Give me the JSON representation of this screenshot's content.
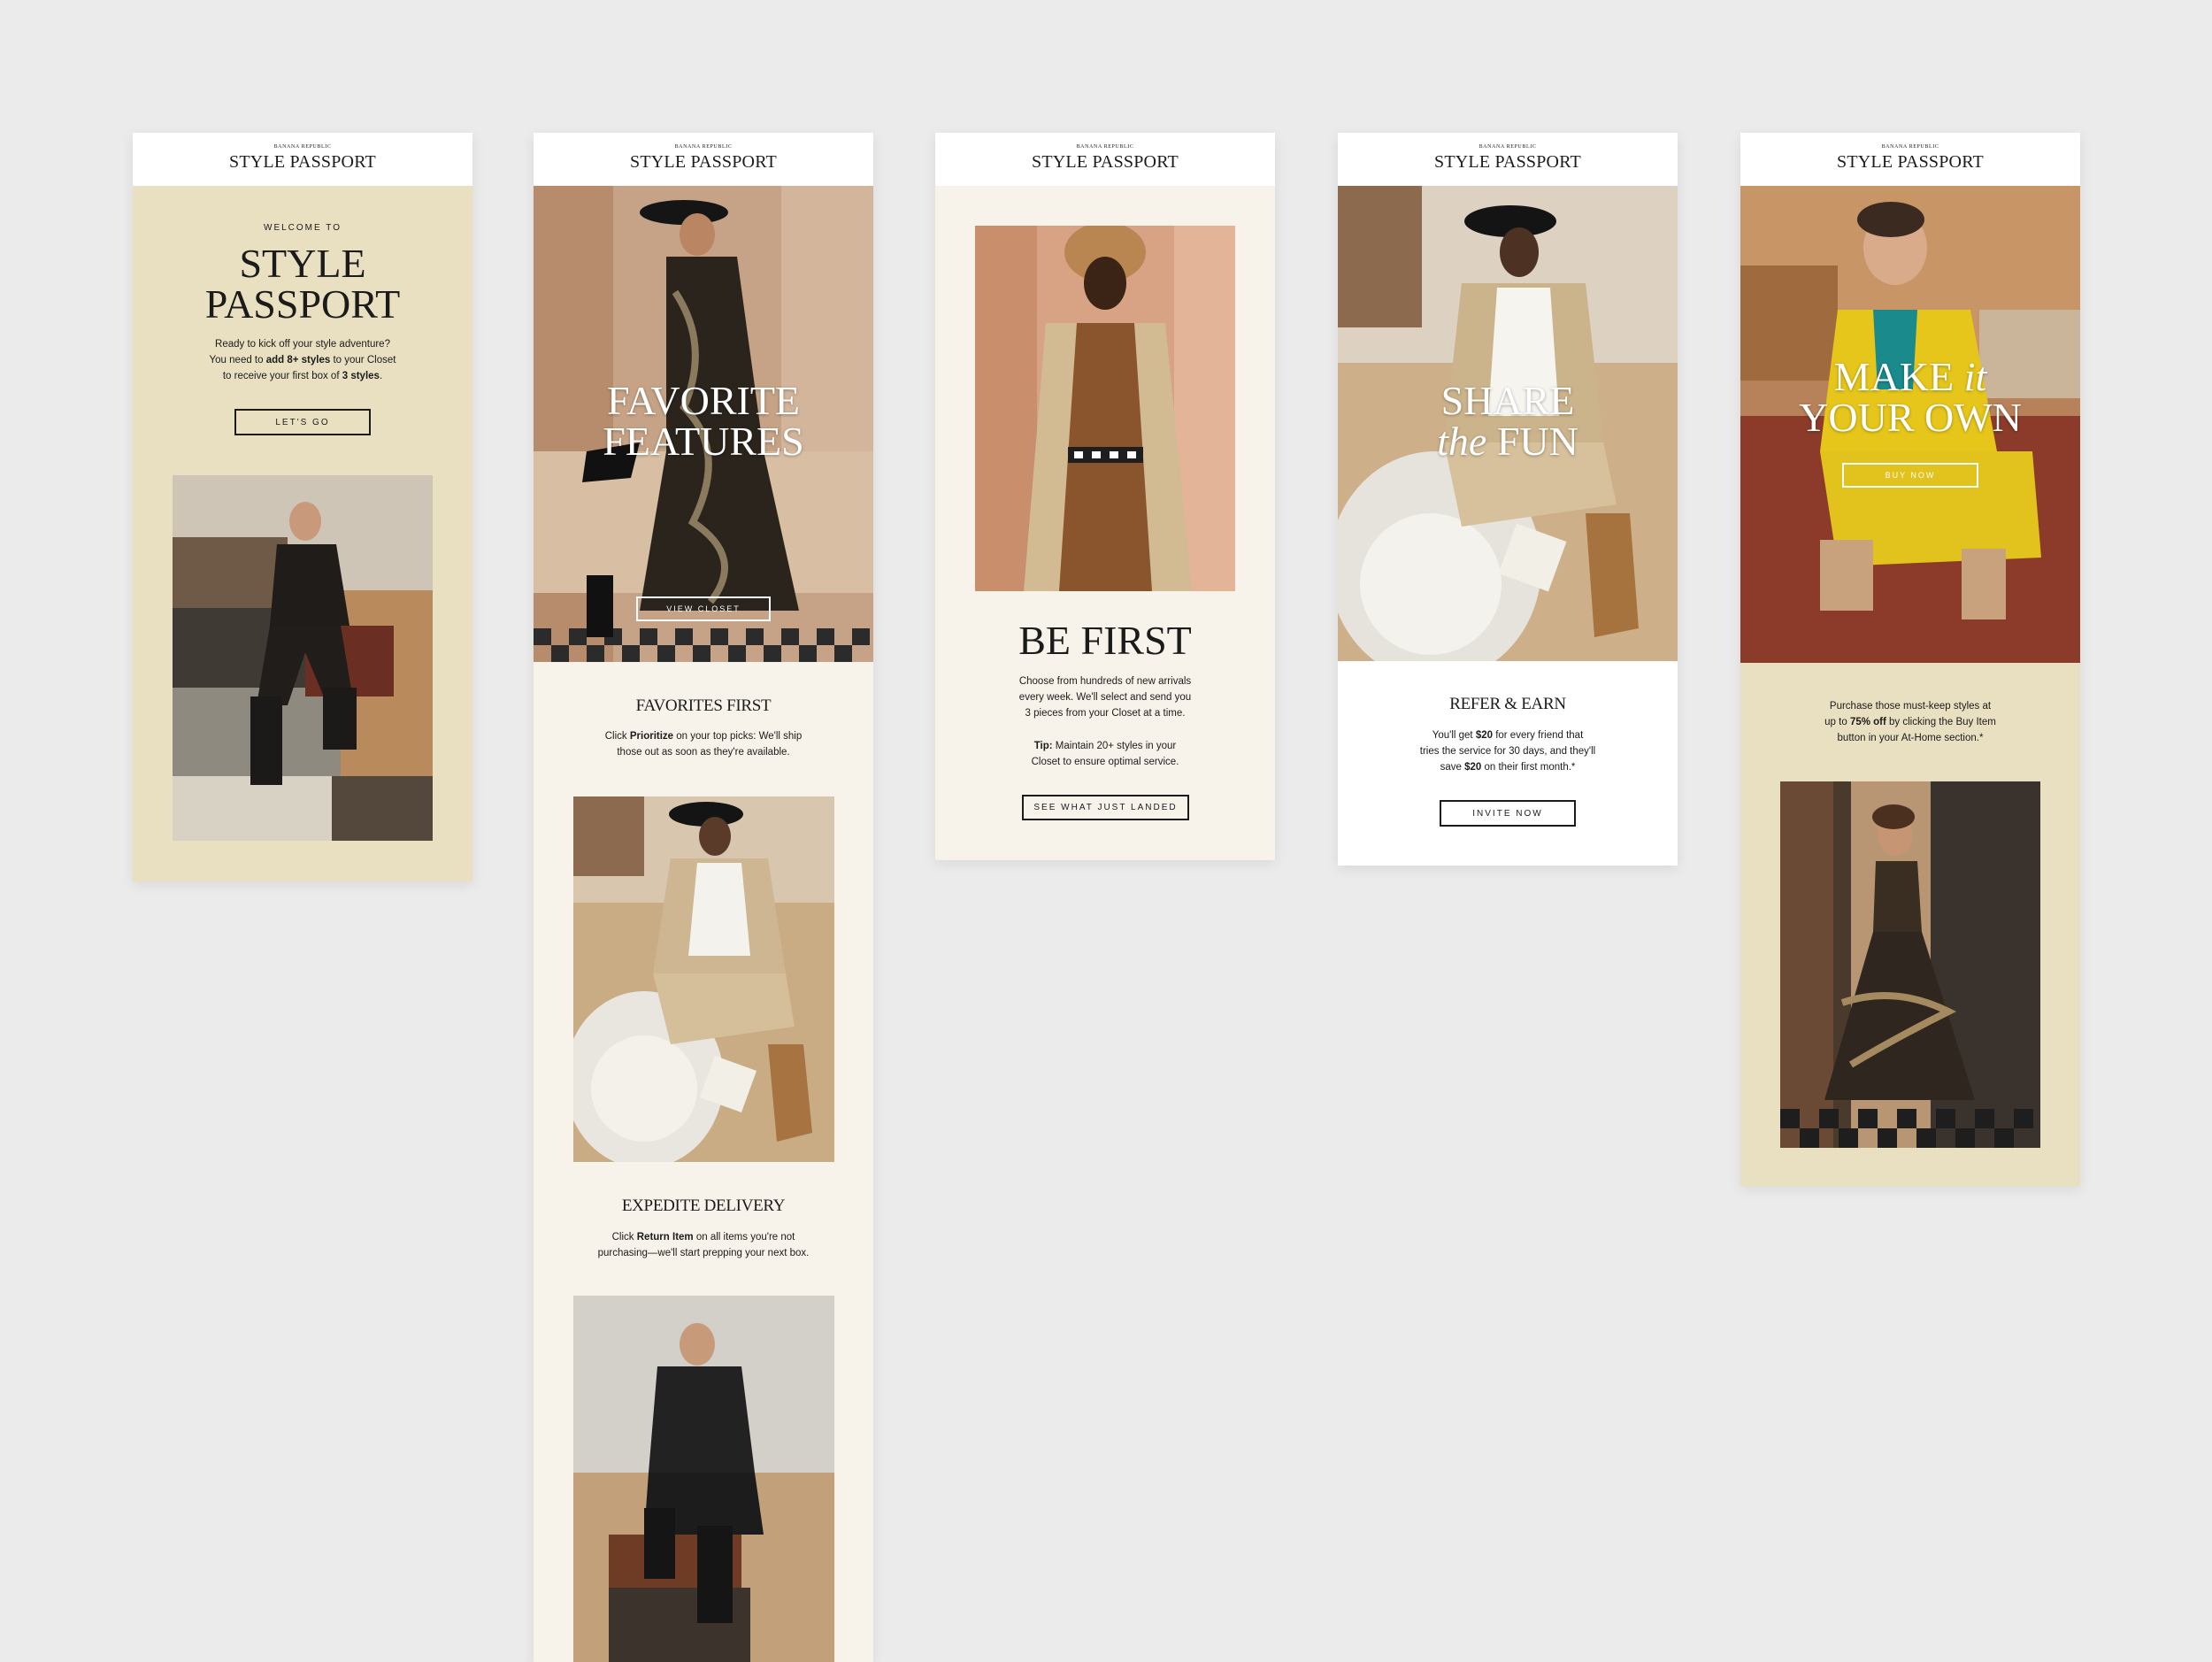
{
  "brand": {
    "parent": "BANANA REPUBLIC",
    "name": "STYLE PASSPORT"
  },
  "colors": {
    "background": "#ebebeb",
    "sand": "#e9dfc1",
    "cream": "#f8f3ea",
    "white": "#ffffff",
    "ink": "#1b1b1b"
  },
  "cards": [
    {
      "eyebrow": "WELCOME TO",
      "title_line1": "STYLE",
      "title_line2": "PASSPORT",
      "body": {
        "line1": "Ready to kick off your style adventure?",
        "line2_a": "You need to ",
        "line2_b": "add 8+ styles",
        "line2_c": " to your Closet",
        "line3_a": "to receive your first box of ",
        "line3_b": "3 styles",
        "line3_c": "."
      },
      "cta": "LET'S GO"
    },
    {
      "hero_line1": "FAVORITE",
      "hero_line2": "FEATURES",
      "hero_cta": "VIEW CLOSET",
      "section1": {
        "title": "FAVORITES FIRST",
        "l1_a": "Click ",
        "l1_b": "Prioritize",
        "l1_c": " on your top picks: We'll ship",
        "l2": "those out as soon as they're available."
      },
      "section2": {
        "title": "EXPEDITE DELIVERY",
        "l1_a": "Click ",
        "l1_b": "Return Item",
        "l1_c": " on all items you're not",
        "l2": "purchasing—we'll start prepping your next box."
      }
    },
    {
      "title": "BE FIRST",
      "body_l1": "Choose from hundreds of new arrivals",
      "body_l2": "every week. We'll select and send you",
      "body_l3": "3 pieces from your Closet at a time.",
      "tip_label": "Tip:",
      "tip_l1": " Maintain 20+ styles in your",
      "tip_l2": "Closet to ensure optimal service.",
      "cta": "SEE WHAT JUST LANDED"
    },
    {
      "hero_line1": "SHARE",
      "hero_line2_italic": "the",
      "hero_line2": " FUN",
      "title": "REFER & EARN",
      "l1_a": "You'll get ",
      "l1_b": "$20",
      "l1_c": " for every friend that",
      "l2": "tries the service for 30 days, and they'll",
      "l3_a": "save ",
      "l3_b": "$20",
      "l3_c": " on their first month.*",
      "cta": "INVITE NOW"
    },
    {
      "hero_line1": "MAKE ",
      "hero_line1_italic": "it",
      "hero_line2": "YOUR OWN",
      "hero_cta": "BUY NOW",
      "l1": "Purchase those must-keep styles at",
      "l2_a": "up to ",
      "l2_b": "75% off",
      "l2_c": " by clicking the Buy Item",
      "l3": "button in your At-Home section.*"
    }
  ]
}
